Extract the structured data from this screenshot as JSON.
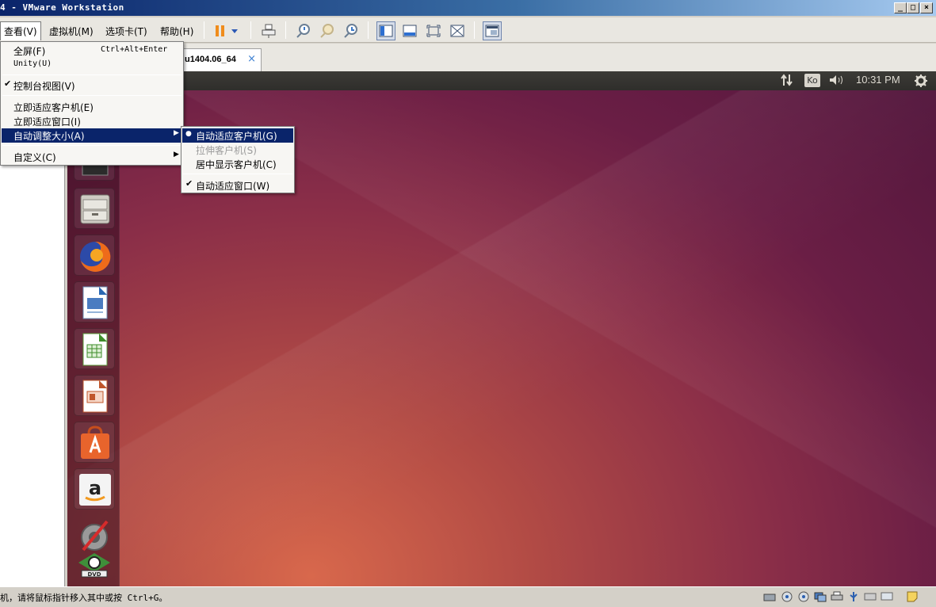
{
  "window": {
    "title": "4 - VMware Workstation",
    "controls": [
      "_",
      "□",
      "×"
    ]
  },
  "menubar": {
    "items": [
      {
        "label": "查看(V)"
      },
      {
        "label": "虚拟机(M)"
      },
      {
        "label": "选项卡(T)"
      },
      {
        "label": "帮助(H)"
      }
    ]
  },
  "toolbar": {
    "icons": [
      "pause-icon",
      "dropdown-arrow-icon",
      "send-ctrl-alt-del-icon",
      "snapshot-take-icon",
      "snapshot-revert-icon",
      "snapshot-manager-icon",
      "library-toggle-icon",
      "thumbnail-bar-icon",
      "fullscreen-icon",
      "unity-icon",
      "console-view-icon"
    ]
  },
  "tab": {
    "label": "u1404.06_64",
    "close": "×"
  },
  "view_menu": {
    "items": [
      {
        "label": "全屏(F)",
        "shortcut": "Ctrl+Alt+Enter"
      },
      {
        "label": "Unity(U)",
        "shortcut": ""
      },
      {
        "label": "控制台视图(V)",
        "checked": "✔"
      },
      {
        "label": "立即适应客户机(E)"
      },
      {
        "label": "立即适应窗口(I)"
      },
      {
        "label": "自动调整大小(A)",
        "arrow": "▶"
      },
      {
        "label": "自定义(C)",
        "arrow": "▶"
      }
    ]
  },
  "autosize_submenu": {
    "items": [
      {
        "label": "自动适应客户机(G)",
        "mark": "●"
      },
      {
        "label": "拉伸客户机(S)",
        "mark": ""
      },
      {
        "label": "居中显示客户机(C)",
        "mark": ""
      },
      {
        "label": "自动适应窗口(W)",
        "mark": "✔"
      }
    ]
  },
  "ubuntu": {
    "panel": {
      "keyboard": "Ko",
      "clock": "10:31 PM"
    },
    "launcher": [
      "terminal-icon",
      "files-icon",
      "firefox-icon",
      "writer-icon",
      "calc-icon",
      "impress-icon",
      "software-center-icon",
      "amazon-icon",
      "system-settings-icon",
      "dvd-icon"
    ],
    "colors": {
      "panel": "#3c3b37",
      "wallpaper_dark": "#51163c",
      "wallpaper_light": "#d8684c"
    }
  },
  "statusbar": {
    "message": "机，请将鼠标指针移入其中或按 Ctrl+G。"
  }
}
